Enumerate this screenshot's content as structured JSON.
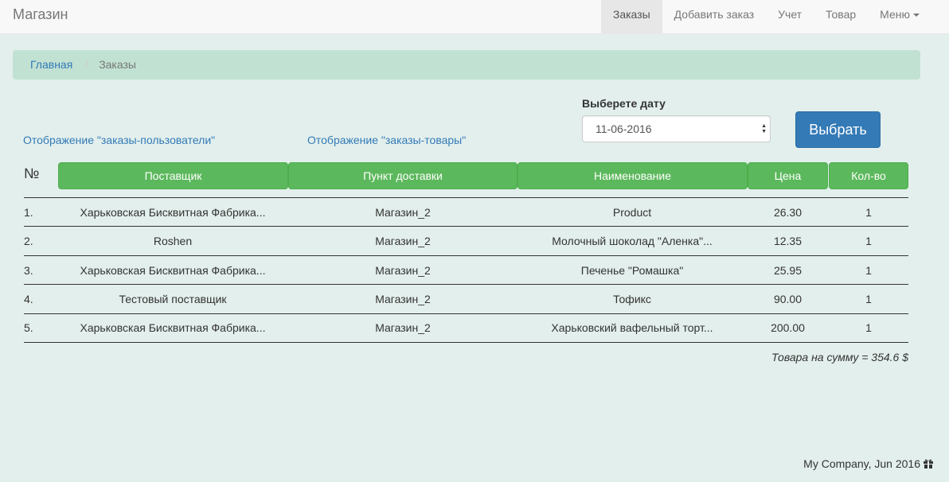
{
  "navbar": {
    "brand": "Магазин",
    "items": [
      {
        "label": "Заказы",
        "active": true
      },
      {
        "label": "Добавить заказ",
        "active": false
      },
      {
        "label": "Учет",
        "active": false
      },
      {
        "label": "Товар",
        "active": false
      },
      {
        "label": "Меню",
        "active": false,
        "dropdown": true
      }
    ]
  },
  "breadcrumb": {
    "home": "Главная",
    "separator": "/",
    "current": "Заказы"
  },
  "links": {
    "orders_users": "Отображение \"заказы-пользователи\"",
    "orders_products": "Отображение \"заказы-товары\""
  },
  "date_picker": {
    "label": "Выберете дату",
    "value": "11-06-2016",
    "button": "Выбрать"
  },
  "table": {
    "number_header": "№",
    "headers": [
      "Поставщик",
      "Пункт доставки",
      "Наименование",
      "Цена",
      "Кол-во"
    ],
    "rows": [
      {
        "num": "1.",
        "supplier": "Харьковская Бисквитная Фабрика...",
        "point": "Магазин_2",
        "name": "Product",
        "price": "26.30",
        "qty": "1"
      },
      {
        "num": "2.",
        "supplier": "Roshen",
        "point": "Магазин_2",
        "name": "Молочный шоколад \"Аленка\"...",
        "price": "12.35",
        "qty": "1"
      },
      {
        "num": "3.",
        "supplier": "Харьковская Бисквитная Фабрика...",
        "point": "Магазин_2",
        "name": "Печенье \"Ромашка\"",
        "price": "25.95",
        "qty": "1"
      },
      {
        "num": "4.",
        "supplier": "Тестовый поставщик",
        "point": "Магазин_2",
        "name": "Тофикс",
        "price": "90.00",
        "qty": "1"
      },
      {
        "num": "5.",
        "supplier": "Харьковская Бисквитная Фабрика...",
        "point": "Магазин_2",
        "name": "Харьковский вафельный торт...",
        "price": "200.00",
        "qty": "1"
      }
    ],
    "total": "Товара на сумму = 354.6 $"
  },
  "footer": {
    "text": "My Company, Jun 2016",
    "icon": "gift-icon"
  },
  "colors": {
    "background": "#e3efec",
    "breadcrumb": "#c1e2d3",
    "header_green": "#5cb85c",
    "primary": "#337ab7"
  }
}
